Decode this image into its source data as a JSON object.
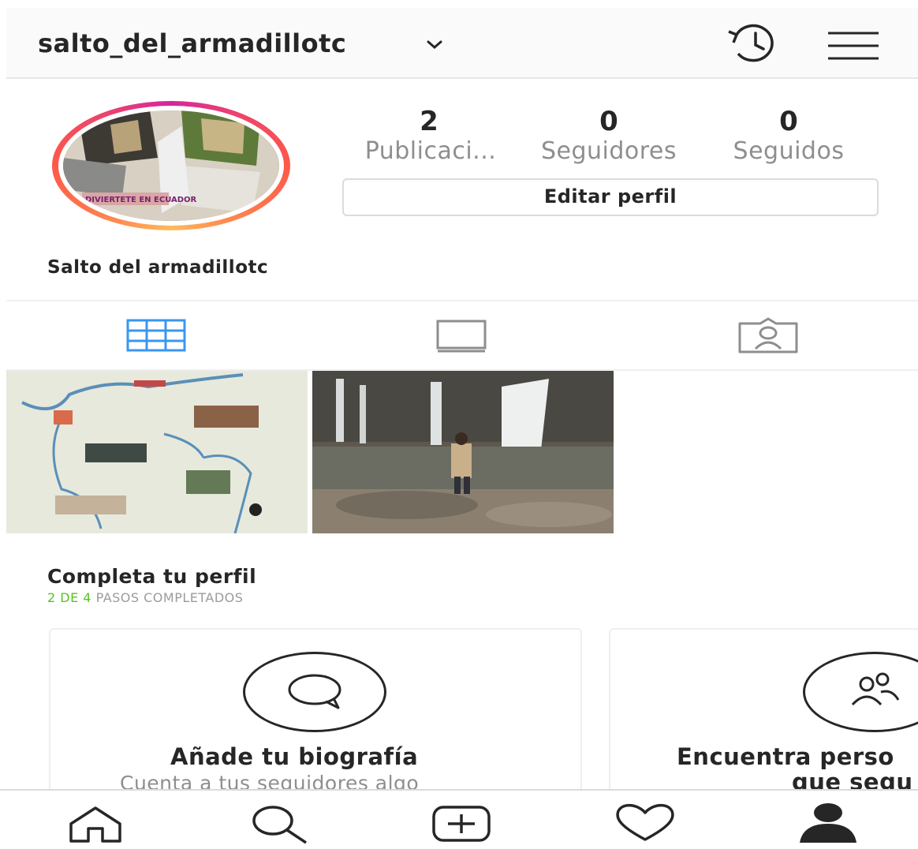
{
  "header": {
    "username": "salto_del_armadillotc",
    "icons": [
      "chevron-down-icon",
      "history-icon",
      "menu-icon"
    ]
  },
  "profile": {
    "stats": [
      {
        "value": "2",
        "label": "Publicaci..."
      },
      {
        "value": "0",
        "label": "Seguidores"
      },
      {
        "value": "0",
        "label": "Seguidos"
      }
    ],
    "edit_label": "Editar perfil",
    "full_name": "Salto del armadillotc",
    "avatar_text": "DIVIERTETE EN ECUADOR"
  },
  "tabs": [
    "grid-icon",
    "feed-icon",
    "tagged-icon"
  ],
  "posts": [
    "map-post",
    "waterfall-post"
  ],
  "complete": {
    "title": "Completa tu perfil",
    "steps_highlight": "2 DE 4",
    "steps_rest": "PASOS COMPLETADOS"
  },
  "cards": [
    {
      "title": "Añade tu biografía",
      "subtitle": "Cuenta a tus seguidores algo",
      "icon": "chat-bubble-icon"
    },
    {
      "title": "Encuentra perso",
      "subtitle": "que segu",
      "icon": "people-icon"
    }
  ],
  "bottom_nav": [
    "home-icon",
    "search-icon",
    "add-post-icon",
    "activity-heart-icon",
    "profile-icon"
  ],
  "colors": {
    "accent_blue": "#3897f0",
    "progress_green": "#58c322",
    "muted_text": "#8e8e8e"
  }
}
